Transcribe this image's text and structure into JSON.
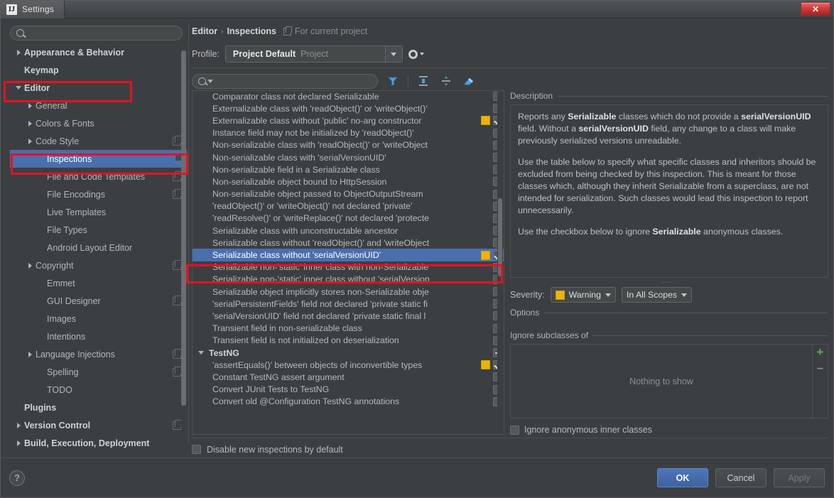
{
  "window": {
    "title": "Settings",
    "app_icon": "idea-logo-icon",
    "close_label": "✕"
  },
  "sidebar": {
    "search": {
      "placeholder": "",
      "value": "",
      "icon": "search-icon"
    },
    "items": [
      {
        "label": "Appearance & Behavior",
        "indent": 0,
        "arrow": "right",
        "bold": true,
        "badge": false,
        "selected": false
      },
      {
        "label": "Keymap",
        "indent": 0,
        "arrow": "none",
        "bold": true,
        "badge": false,
        "selected": false
      },
      {
        "label": "Editor",
        "indent": 0,
        "arrow": "down",
        "bold": true,
        "badge": false,
        "selected": false
      },
      {
        "label": "General",
        "indent": 1,
        "arrow": "right",
        "bold": false,
        "badge": false,
        "selected": false
      },
      {
        "label": "Colors & Fonts",
        "indent": 1,
        "arrow": "right",
        "bold": false,
        "badge": false,
        "selected": false
      },
      {
        "label": "Code Style",
        "indent": 1,
        "arrow": "right",
        "bold": false,
        "badge": true,
        "selected": false
      },
      {
        "label": "Inspections",
        "indent": 2,
        "arrow": "none",
        "bold": false,
        "badge": true,
        "selected": true
      },
      {
        "label": "File and Code Templates",
        "indent": 2,
        "arrow": "none",
        "bold": false,
        "badge": true,
        "selected": false
      },
      {
        "label": "File Encodings",
        "indent": 2,
        "arrow": "none",
        "bold": false,
        "badge": true,
        "selected": false
      },
      {
        "label": "Live Templates",
        "indent": 2,
        "arrow": "none",
        "bold": false,
        "badge": false,
        "selected": false
      },
      {
        "label": "File Types",
        "indent": 2,
        "arrow": "none",
        "bold": false,
        "badge": false,
        "selected": false
      },
      {
        "label": "Android Layout Editor",
        "indent": 2,
        "arrow": "none",
        "bold": false,
        "badge": false,
        "selected": false
      },
      {
        "label": "Copyright",
        "indent": 1,
        "arrow": "right",
        "bold": false,
        "badge": true,
        "selected": false
      },
      {
        "label": "Emmet",
        "indent": 2,
        "arrow": "none",
        "bold": false,
        "badge": false,
        "selected": false
      },
      {
        "label": "GUI Designer",
        "indent": 2,
        "arrow": "none",
        "bold": false,
        "badge": true,
        "selected": false
      },
      {
        "label": "Images",
        "indent": 2,
        "arrow": "none",
        "bold": false,
        "badge": false,
        "selected": false
      },
      {
        "label": "Intentions",
        "indent": 2,
        "arrow": "none",
        "bold": false,
        "badge": false,
        "selected": false
      },
      {
        "label": "Language Injections",
        "indent": 1,
        "arrow": "right",
        "bold": false,
        "badge": true,
        "selected": false
      },
      {
        "label": "Spelling",
        "indent": 2,
        "arrow": "none",
        "bold": false,
        "badge": true,
        "selected": false
      },
      {
        "label": "TODO",
        "indent": 2,
        "arrow": "none",
        "bold": false,
        "badge": false,
        "selected": false
      },
      {
        "label": "Plugins",
        "indent": 0,
        "arrow": "none",
        "bold": true,
        "badge": false,
        "selected": false
      },
      {
        "label": "Version Control",
        "indent": 0,
        "arrow": "right",
        "bold": true,
        "badge": true,
        "selected": false
      },
      {
        "label": "Build, Execution, Deployment",
        "indent": 0,
        "arrow": "right",
        "bold": true,
        "badge": false,
        "selected": false
      }
    ]
  },
  "header": {
    "breadcrumb_parent": "Editor",
    "breadcrumb_separator": "›",
    "breadcrumb_current": "Inspections",
    "scope_note": "For current project",
    "scope_icon": "copy-icon",
    "profile_label": "Profile:",
    "profile_name": "Project Default",
    "profile_kind": "Project",
    "gear_icon": "gear-icon"
  },
  "toolbar": {
    "filter_placeholder": "",
    "filter_value": "",
    "search_icon": "search-icon",
    "icons": [
      {
        "name": "filter-funnel-icon",
        "title": "Filter inspections"
      },
      {
        "name": "expand-all-icon",
        "title": "Expand all"
      },
      {
        "name": "collapse-all-icon",
        "title": "Collapse all"
      },
      {
        "name": "reset-eraser-icon",
        "title": "Reset to defaults"
      }
    ]
  },
  "inspections": [
    {
      "label": "Comparator class not declared Serializable",
      "group": false,
      "severity": "none",
      "check": "off",
      "selected": false
    },
    {
      "label": "Externalizable class with 'readObject()' or 'writeObject()'",
      "group": false,
      "severity": "none",
      "check": "off",
      "selected": false
    },
    {
      "label": "Externalizable class without 'public' no-arg constructor",
      "group": false,
      "severity": "warning",
      "check": "on",
      "selected": false
    },
    {
      "label": "Instance field may not be initialized by 'readObject()'",
      "group": false,
      "severity": "none",
      "check": "off",
      "selected": false
    },
    {
      "label": "Non-serializable class with 'readObject()' or 'writeObject",
      "group": false,
      "severity": "none",
      "check": "off",
      "selected": false
    },
    {
      "label": "Non-serializable class with 'serialVersionUID'",
      "group": false,
      "severity": "none",
      "check": "off",
      "selected": false
    },
    {
      "label": "Non-serializable field in a Serializable class",
      "group": false,
      "severity": "none",
      "check": "off",
      "selected": false
    },
    {
      "label": "Non-serializable object bound to HttpSession",
      "group": false,
      "severity": "none",
      "check": "off",
      "selected": false
    },
    {
      "label": "Non-serializable object passed to ObjectOutputStream",
      "group": false,
      "severity": "none",
      "check": "off",
      "selected": false
    },
    {
      "label": "'readObject()' or 'writeObject()' not declared 'private'",
      "group": false,
      "severity": "none",
      "check": "off",
      "selected": false
    },
    {
      "label": "'readResolve()' or 'writeReplace()' not declared 'protecte",
      "group": false,
      "severity": "none",
      "check": "off",
      "selected": false
    },
    {
      "label": "Serializable class with unconstructable ancestor",
      "group": false,
      "severity": "none",
      "check": "off",
      "selected": false
    },
    {
      "label": "Serializable class without 'readObject()' and 'writeObject",
      "group": false,
      "severity": "none",
      "check": "off",
      "selected": false
    },
    {
      "label": "Serializable class without 'serialVersionUID'",
      "group": false,
      "severity": "warning",
      "check": "on",
      "selected": true
    },
    {
      "label": "Serializable non-'static' inner class with non-Serializable",
      "group": false,
      "severity": "none",
      "check": "off",
      "selected": false
    },
    {
      "label": "Serializable non-'static' inner class without 'serialVersion",
      "group": false,
      "severity": "none",
      "check": "off",
      "selected": false
    },
    {
      "label": "Serializable object implicitly stores non-Serializable obje",
      "group": false,
      "severity": "none",
      "check": "off",
      "selected": false
    },
    {
      "label": "'serialPersistentFields' field not declared 'private static fi",
      "group": false,
      "severity": "none",
      "check": "off",
      "selected": false
    },
    {
      "label": "'serialVersionUID' field not declared 'private static final l",
      "group": false,
      "severity": "none",
      "check": "off",
      "selected": false
    },
    {
      "label": "Transient field in non-serializable class",
      "group": false,
      "severity": "none",
      "check": "off",
      "selected": false
    },
    {
      "label": "Transient field is not initialized on deserialization",
      "group": false,
      "severity": "none",
      "check": "off",
      "selected": false
    },
    {
      "label": "TestNG",
      "group": true,
      "severity": "none",
      "check": "dash",
      "selected": false
    },
    {
      "label": "'assertEquals()' between objects of inconvertible types",
      "group": false,
      "severity": "warning",
      "check": "on",
      "selected": false
    },
    {
      "label": "Constant TestNG assert argument",
      "group": false,
      "severity": "none",
      "check": "off",
      "selected": false
    },
    {
      "label": "Convert JUnit Tests to TestNG",
      "group": false,
      "severity": "none",
      "check": "off",
      "selected": false
    },
    {
      "label": "Convert old @Configuration TestNG annotations",
      "group": false,
      "severity": "none",
      "check": "off",
      "selected": false
    }
  ],
  "bottom_option": {
    "label": "Disable new inspections by default",
    "checked": false
  },
  "description": {
    "legend": "Description",
    "para1_a": "Reports any ",
    "para1_b": "Serializable",
    "para1_c": " classes which do not provide a ",
    "para1_d": "serialVersionUID",
    "para1_e": " field. Without a ",
    "para1_f": "serialVersionUID",
    "para1_g": " field, any change to a class will make previously serialized versions unreadable.",
    "para2": "Use the table below to specify what specific classes and inheritors should be excluded from being checked by this inspection. This is meant for those classes which, although they inherit Serializable from a superclass, are not intended for serialization. Such classes would lead this inspection to report unnecessarily.",
    "para3_a": "Use the checkbox below to ignore ",
    "para3_b": "Serializable",
    "para3_c": " anonymous classes."
  },
  "severity": {
    "label": "Severity:",
    "value": "Warning",
    "color": "#edb20c",
    "scope": "In All Scopes"
  },
  "options": {
    "legend": "Options",
    "ignore_legend": "Ignore subclasses of",
    "empty_text": "Nothing to show",
    "add_icon": "plus-icon",
    "remove_icon": "minus-icon",
    "ignore_anon_label": "Ignore anonymous inner classes",
    "ignore_anon_checked": false
  },
  "footer": {
    "help_icon": "help-question-icon",
    "ok": "OK",
    "cancel": "Cancel",
    "apply": "Apply"
  }
}
